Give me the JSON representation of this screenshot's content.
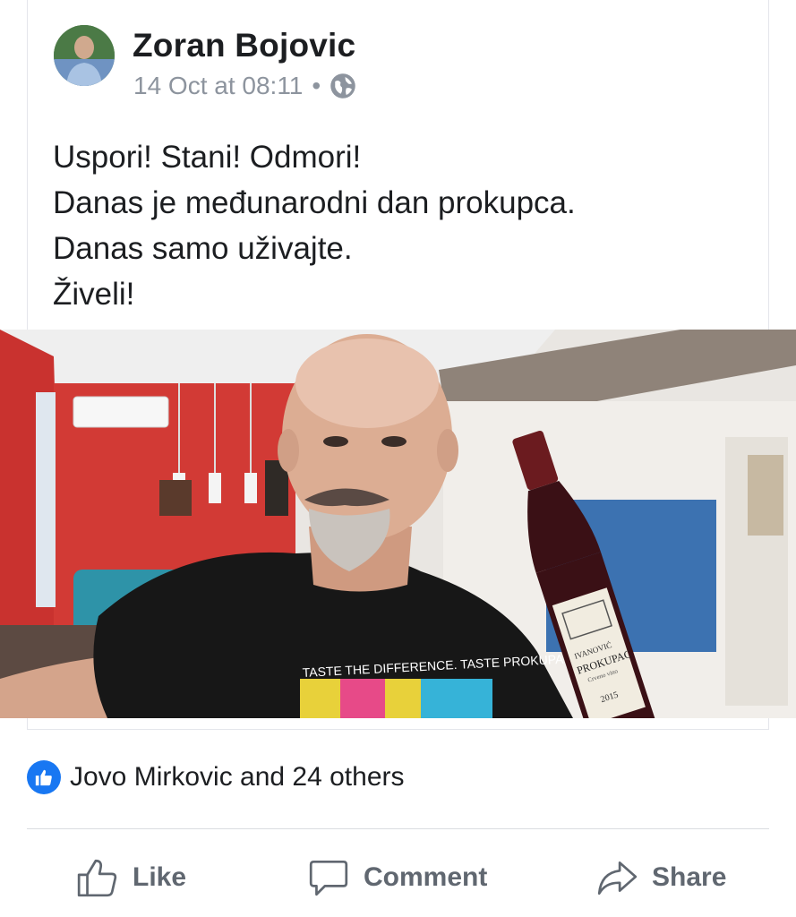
{
  "post": {
    "author": "Zoran Bojovic",
    "timestamp": "14 Oct at 08:11",
    "separator": "•",
    "privacy_icon": "globe-icon",
    "text_lines": [
      "Uspori! Stani! Odmori!",
      "Danas je međunarodni dan prokupca.",
      "Danas samo uživajte.",
      "Živeli!"
    ],
    "photo": {
      "shirt_text": "TASTE THE DIFFERENCE. TASTE PROKUPAC",
      "label_brand": "IVANOVIĆ",
      "label_name": "PROKUPAC",
      "label_sub": "Crveno vino",
      "label_year": "2015"
    }
  },
  "reactions": {
    "icon": "thumbs-up-icon",
    "summary": "Jovo Mirkovic and 24 others"
  },
  "actions": {
    "like": "Like",
    "comment": "Comment",
    "share": "Share"
  },
  "colors": {
    "brand": "#1877f2",
    "muted": "#8d949e",
    "action": "#606770"
  }
}
